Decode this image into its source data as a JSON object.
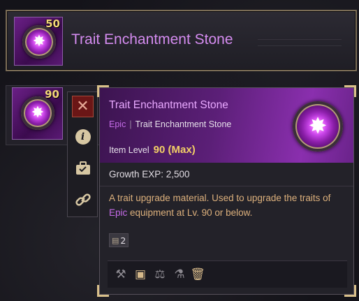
{
  "header": {
    "title": "Trait Enchantment Stone",
    "quantity": "50"
  },
  "slot": {
    "quantity": "90"
  },
  "side_actions": {
    "close_symbol": "✕",
    "info_symbol": "i",
    "box_symbol": "🗳",
    "link_symbol": "🔗"
  },
  "tooltip": {
    "name": "Trait Enchantment Stone",
    "grade": "Epic",
    "category": "Trait Enchantment Stone",
    "item_level_label": "Item Level",
    "item_level_value": "90 (Max)",
    "growth": "Growth EXP: 2,500",
    "desc_part1": "A trait upgrade material. Used to upgrade the traits of ",
    "desc_grade": "Epic",
    "desc_part2": " equipment at Lv. 90 or below.",
    "trade_count": "2",
    "bottom_icons": [
      "extract-icon",
      "box-icon",
      "scale-icon",
      "flask-icon",
      "trash-icon"
    ]
  },
  "colors": {
    "epic": "#c56be8",
    "gold": "#f2cf66",
    "frame": "#d9c08a"
  }
}
